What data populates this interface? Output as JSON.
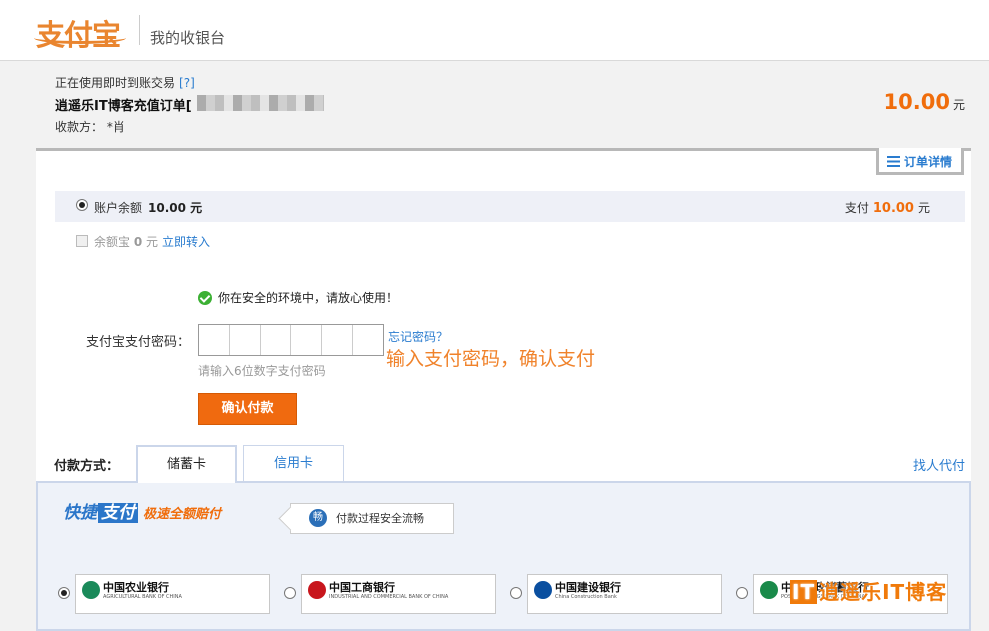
{
  "header": {
    "logo_text": "支付宝",
    "title": "我的收银台"
  },
  "order": {
    "mode_text": "正在使用即时到账交易",
    "mode_help": "[?]",
    "name": "逍遥乐IT博客充值订单[",
    "payee": "收款方：  *肖",
    "amount": "10.00",
    "unit": "元"
  },
  "detail_tab": "订单详情",
  "balance": {
    "label": "账户余额",
    "value": "10.00 元",
    "pay_label": "支付",
    "pay_value": "10.00",
    "pay_unit": "元"
  },
  "yuebao": {
    "label": "余额宝",
    "value": "0",
    "unit": "元",
    "link": "立即转入"
  },
  "security_note": "你在安全的环境中，请放心使用！",
  "password": {
    "label": "支付宝支付密码：",
    "forgot": "忘记密码？",
    "hint": "请输入6位数字支付密码"
  },
  "annotation": "输入支付密码，确认支付",
  "confirm_button": "确认付款",
  "payment": {
    "label": "付款方式：",
    "tabs": [
      "储蓄卡",
      "信用卡"
    ],
    "agent_link": "找人代付"
  },
  "quick_pay": {
    "brand_a": "快捷",
    "brand_b": "支付",
    "slogan": "极速全额赔付",
    "flow_icon": "畅",
    "flow_text": "付款过程安全流畅"
  },
  "banks": [
    {
      "name": "中国农业银行",
      "en": "AGRICULTURAL BANK OF CHINA",
      "color": "#1a8a5a"
    },
    {
      "name": "中国工商银行",
      "en": "INDUSTRIAL AND COMMERCIAL BANK OF CHINA",
      "color": "#c8161d"
    },
    {
      "name": "中国建设银行",
      "en": "China Construction Bank",
      "color": "#0a4fa0"
    },
    {
      "name": "中国邮政储蓄银行",
      "en": "POSTAL SAVINGS BANK OF CHINA",
      "color": "#1a8a4a"
    }
  ],
  "watermark": {
    "prefix": "IT",
    "text": "逍遥乐IT博客"
  }
}
